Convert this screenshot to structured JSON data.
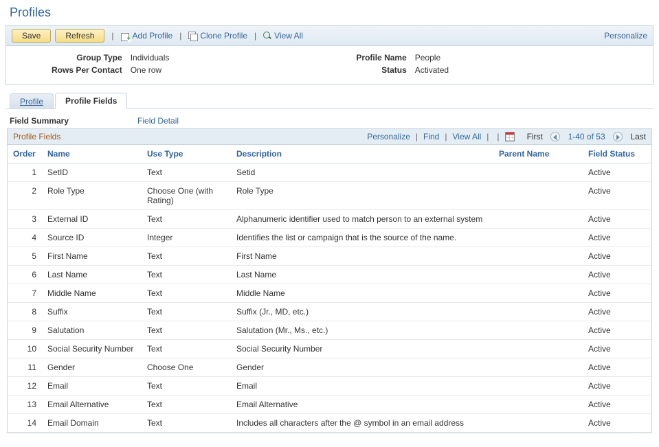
{
  "page_title": "Profiles",
  "toolbar": {
    "save": "Save",
    "refresh": "Refresh",
    "add_profile": "Add Profile",
    "clone_profile": "Clone Profile",
    "view_all": "View All",
    "personalize": "Personalize"
  },
  "summary": {
    "group_type_label": "Group Type",
    "group_type_value": "Individuals",
    "rows_per_contact_label": "Rows Per Contact",
    "rows_per_contact_value": "One row",
    "profile_name_label": "Profile Name",
    "profile_name_value": "People",
    "status_label": "Status",
    "status_value": "Activated"
  },
  "tabs": {
    "profile": "Profile",
    "profile_fields": "Profile Fields"
  },
  "sub": {
    "field_summary": "Field Summary",
    "field_detail": "Field Detail"
  },
  "grid": {
    "title": "Profile Fields",
    "personalize": "Personalize",
    "find": "Find",
    "view_all": "View All",
    "first": "First",
    "range": "1-40 of 53",
    "last": "Last",
    "headers": {
      "order": "Order",
      "name": "Name",
      "use_type": "Use Type",
      "description": "Description",
      "parent_name": "Parent Name",
      "field_status": "Field Status"
    },
    "rows": [
      {
        "order": "1",
        "name": "SetID",
        "use": "Text",
        "desc": "Setid",
        "parent": "",
        "status": "Active"
      },
      {
        "order": "2",
        "name": "Role Type",
        "use": "Choose One (with Rating)",
        "desc": "Role Type",
        "parent": "",
        "status": "Active"
      },
      {
        "order": "3",
        "name": "External ID",
        "use": "Text",
        "desc": "Alphanumeric identifier used to match person to an external system",
        "parent": "",
        "status": "Active"
      },
      {
        "order": "4",
        "name": "Source ID",
        "use": "Integer",
        "desc": "Identifies the list or campaign that is the source of the name.",
        "parent": "",
        "status": "Active"
      },
      {
        "order": "5",
        "name": "First Name",
        "use": "Text",
        "desc": "First Name",
        "parent": "",
        "status": "Active"
      },
      {
        "order": "6",
        "name": "Last Name",
        "use": "Text",
        "desc": "Last Name",
        "parent": "",
        "status": "Active"
      },
      {
        "order": "7",
        "name": "Middle Name",
        "use": "Text",
        "desc": "Middle Name",
        "parent": "",
        "status": "Active"
      },
      {
        "order": "8",
        "name": "Suffix",
        "use": "Text",
        "desc": "Suffix  (Jr., MD, etc.)",
        "parent": "",
        "status": "Active"
      },
      {
        "order": "9",
        "name": "Salutation",
        "use": "Text",
        "desc": "Salutation (Mr., Ms., etc.)",
        "parent": "",
        "status": "Active"
      },
      {
        "order": "10",
        "name": "Social Security Number",
        "use": "Text",
        "desc": "Social Security Number",
        "parent": "",
        "status": "Active"
      },
      {
        "order": "11",
        "name": "Gender",
        "use": "Choose One",
        "desc": "Gender",
        "parent": "",
        "status": "Active"
      },
      {
        "order": "12",
        "name": "Email",
        "use": "Text",
        "desc": "Email",
        "parent": "",
        "status": "Active"
      },
      {
        "order": "13",
        "name": "Email Alternative",
        "use": "Text",
        "desc": "Email Alternative",
        "parent": "",
        "status": "Active"
      },
      {
        "order": "14",
        "name": "Email Domain",
        "use": "Text",
        "desc": "Includes all characters after the @ symbol in an email address",
        "parent": "",
        "status": "Active"
      }
    ]
  }
}
